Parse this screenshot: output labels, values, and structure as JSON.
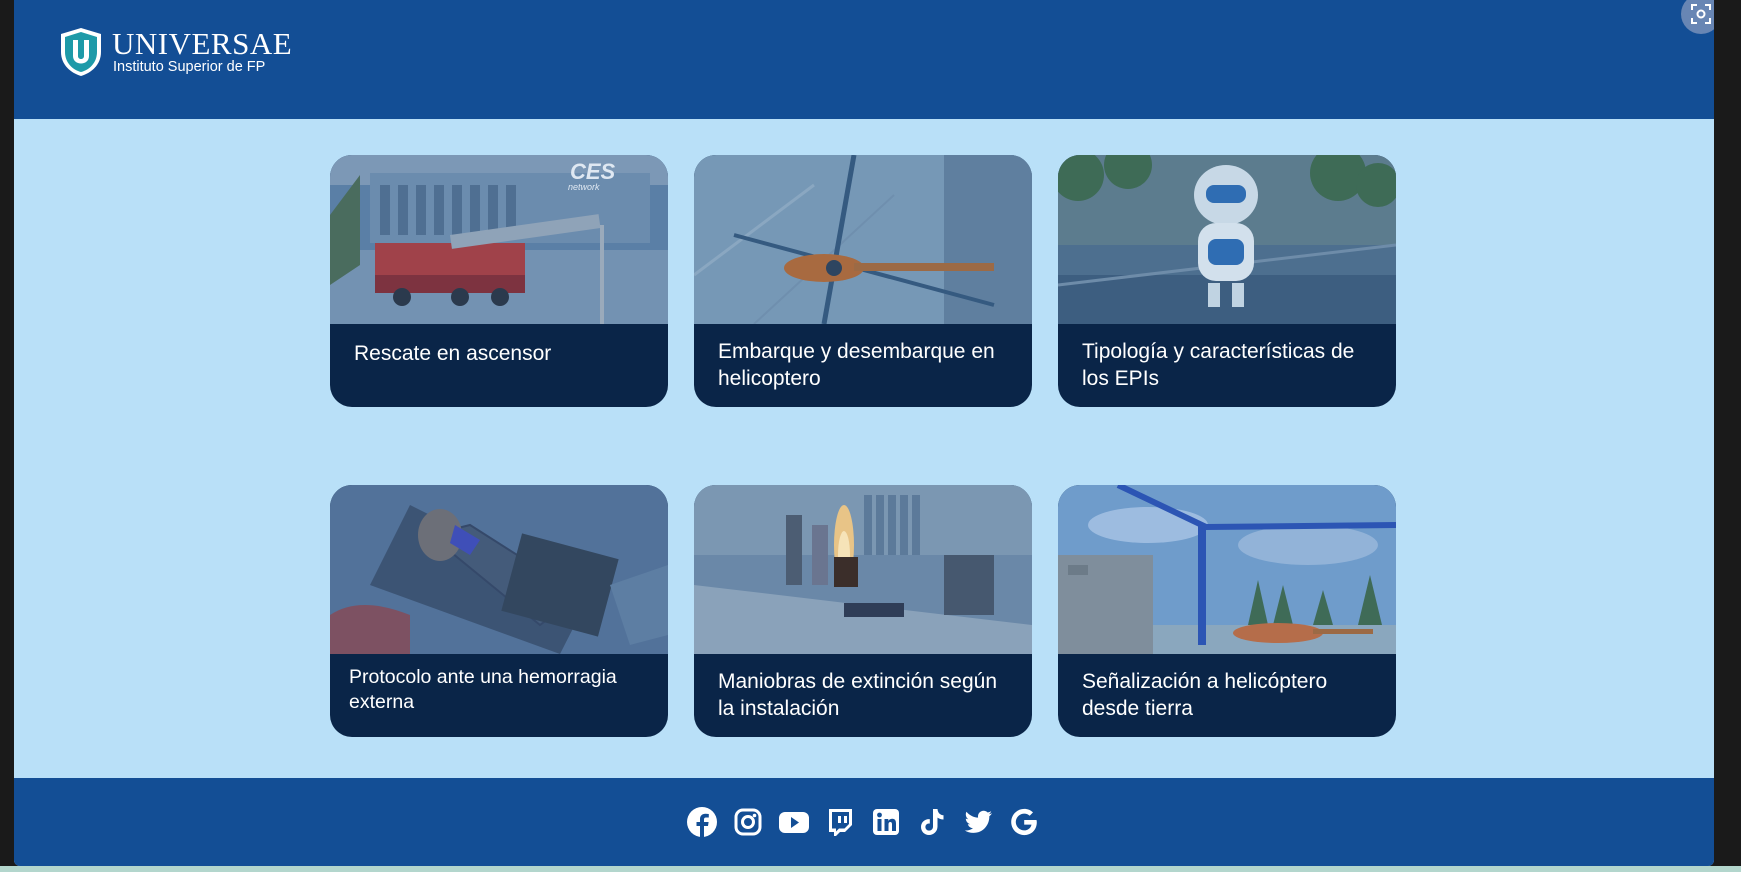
{
  "header": {
    "logo_name": "UNIVERSAE",
    "logo_subtitle": "Instituto Superior de FP"
  },
  "cards": [
    {
      "label": "Rescate en ascensor",
      "image": "fire-truck-scene",
      "image_text": "CES network"
    },
    {
      "label": "Embarque y desembarque en helicoptero",
      "image": "helicopter-top-view"
    },
    {
      "label": "Tipología y características de los EPIs",
      "image": "robot-mascot"
    },
    {
      "label": "Protocolo ante una hemorragia externa",
      "image": "injured-person"
    },
    {
      "label": "Maniobras de extinción según la instalación",
      "image": "office-fire-scene"
    },
    {
      "label": "Señalización a helicóptero desde tierra",
      "image": "crane-helicopter-scene"
    }
  ],
  "footer": {
    "social": [
      "facebook-icon",
      "instagram-icon",
      "youtube-icon",
      "twitch-icon",
      "linkedin-icon",
      "tiktok-icon",
      "twitter-icon",
      "google-icon"
    ]
  },
  "colors": {
    "header_bg": "#134e95",
    "page_bg": "#b9e0f8",
    "card_bg": "#0a2548"
  }
}
